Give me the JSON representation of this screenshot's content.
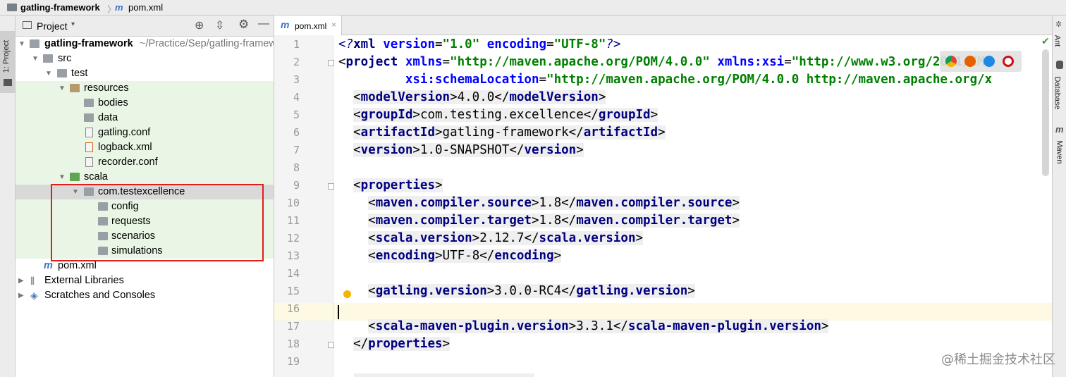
{
  "breadcrumb": {
    "project": "gatling-framework",
    "separator": "〉",
    "file": "pom.xml"
  },
  "left_tool_strip": {
    "project_tab": "1: Project"
  },
  "right_tool_strip": {
    "ant": "Ant",
    "database": "Database",
    "maven": "Maven"
  },
  "project_panel": {
    "header": {
      "title": "Project"
    },
    "tree": [
      {
        "label": "gatling-framework",
        "hint": "~/Practice/Sep/gatling-framew",
        "bold": true
      },
      {
        "label": "src"
      },
      {
        "label": "test"
      },
      {
        "label": "resources"
      },
      {
        "label": "bodies"
      },
      {
        "label": "data"
      },
      {
        "label": "gatling.conf"
      },
      {
        "label": "logback.xml"
      },
      {
        "label": "recorder.conf"
      },
      {
        "label": "scala"
      },
      {
        "label": "com.testexcellence"
      },
      {
        "label": "config"
      },
      {
        "label": "requests"
      },
      {
        "label": "scenarios"
      },
      {
        "label": "simulations"
      },
      {
        "label": "pom.xml"
      },
      {
        "label": "External Libraries"
      },
      {
        "label": "Scratches and Consoles"
      }
    ]
  },
  "editor": {
    "tab_label": "pom.xml",
    "line_numbers": [
      "1",
      "2",
      "3",
      "4",
      "5",
      "6",
      "7",
      "8",
      "9",
      "10",
      "11",
      "12",
      "13",
      "14",
      "15",
      "16",
      "17",
      "18",
      "19"
    ],
    "lines": {
      "l1": {
        "a": "<?",
        "b": "xml ",
        "c": "version",
        "d": "=",
        "e": "\"1.0\"",
        "f": " encoding",
        "g": "=",
        "h": "\"UTF-8\"",
        "i": "?>"
      },
      "l2": {
        "a": "<",
        "b": "project",
        "c": " xmlns",
        "d": "=",
        "e": "\"http://maven.apache.org/POM/4.0.0\"",
        "f": " xmlns:xsi",
        "g": "=",
        "h": "\"http://www.w3.org/2001/XMI"
      },
      "l3": {
        "a": "xsi:schemaLocation",
        "b": "=",
        "c": "\"http://maven.apache.org/POM/4.0.0 http://maven.apache.org/x"
      },
      "l4": {
        "tag": "modelVersion",
        "value": "4.0.0"
      },
      "l5": {
        "tag": "groupId",
        "value": "com.testing.excellence"
      },
      "l6": {
        "tag": "artifactId",
        "value": "gatling-framework"
      },
      "l7": {
        "tag": "version",
        "value": "1.0-SNAPSHOT"
      },
      "l9": {
        "tag": "properties"
      },
      "l10": {
        "tag": "maven.compiler.source",
        "value": "1.8"
      },
      "l11": {
        "tag": "maven.compiler.target",
        "value": "1.8"
      },
      "l12": {
        "tag": "scala.version",
        "value": "2.12.7"
      },
      "l13": {
        "tag": "encoding",
        "value": "UTF-8"
      },
      "l15": {
        "tag": "gatling.version",
        "value": "3.0.0-RC4"
      },
      "l17": {
        "tag": "scala-maven-plugin.version",
        "value": "3.3.1"
      },
      "l18": {
        "tag": "properties"
      }
    }
  },
  "watermark": "@稀土掘金技术社区",
  "colors": {
    "tag": "#000080",
    "attr": "#0000ff",
    "value": "#008000",
    "highlight": "#e21d1d",
    "current_line": "#fdf9e2",
    "source_green": "#eaf6e5"
  }
}
